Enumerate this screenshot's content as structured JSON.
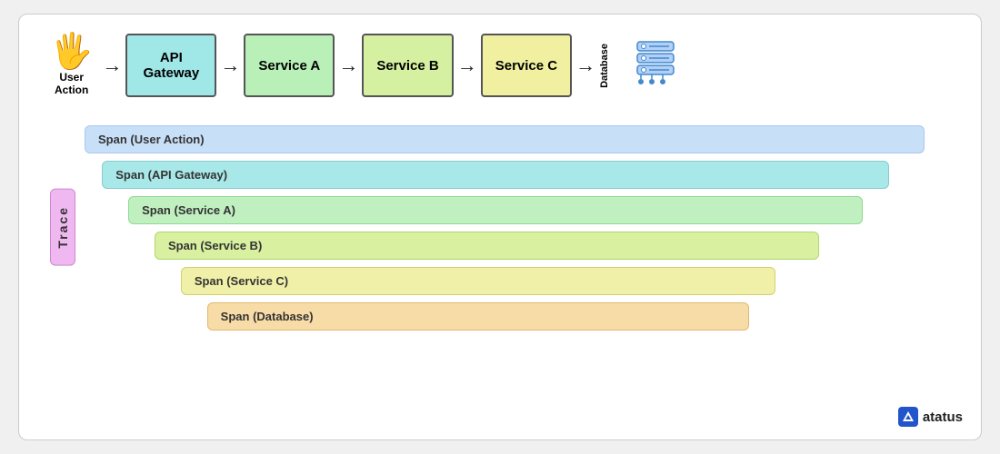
{
  "diagram": {
    "user_action": {
      "label": "User\nAction",
      "icon": "✋"
    },
    "nodes": [
      {
        "id": "api-gateway",
        "label": "API\nGateway",
        "color_class": "box-api"
      },
      {
        "id": "service-a",
        "label": "Service A",
        "color_class": "box-serviceA"
      },
      {
        "id": "service-b",
        "label": "Service B",
        "color_class": "box-serviceB"
      },
      {
        "id": "service-c",
        "label": "Service C",
        "color_class": "box-serviceC"
      }
    ],
    "database_label": "Database"
  },
  "trace": {
    "label": "Trace",
    "spans": [
      {
        "id": "span-user-action",
        "label": "Span (User Action)",
        "css_class": "span-user-action"
      },
      {
        "id": "span-api-gateway",
        "label": "Span (API Gateway)",
        "css_class": "span-api-gateway"
      },
      {
        "id": "span-service-a",
        "label": "Span (Service A)",
        "css_class": "span-service-a"
      },
      {
        "id": "span-service-b",
        "label": "Span (Service B)",
        "css_class": "span-service-b"
      },
      {
        "id": "span-service-c",
        "label": "Span (Service C)",
        "css_class": "span-service-c"
      },
      {
        "id": "span-database",
        "label": "Span (Database)",
        "css_class": "span-database"
      }
    ]
  },
  "branding": {
    "name": "atatus",
    "icon_letter": "a"
  }
}
